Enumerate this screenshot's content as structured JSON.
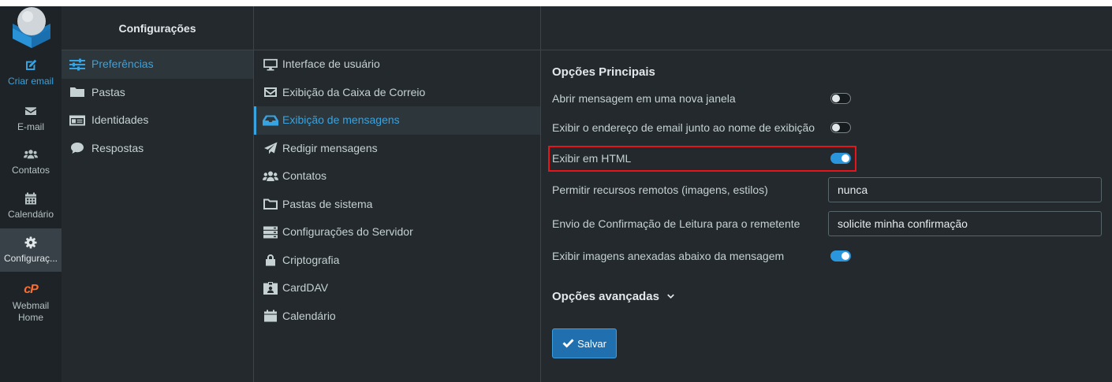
{
  "colors": {
    "background": "#23292d",
    "menu_background": "#1d2326",
    "accent": "#37a3e1",
    "toggle_on": "#2a97dc",
    "text": "#c5d1d3",
    "highlight_border": "#e8141c",
    "cpanel_orange": "#ff6c2c",
    "save_button": "#2070b0"
  },
  "menu": {
    "logo_icon": "roundcube-logo-icon",
    "items": [
      {
        "label": "Criar email",
        "icon": "compose-icon",
        "active": false
      },
      {
        "label": "E-mail",
        "icon": "envelope-icon",
        "active": false
      },
      {
        "label": "Contatos",
        "icon": "users-icon",
        "active": false
      },
      {
        "label": "Calendário",
        "icon": "calendar-icon",
        "active": false
      },
      {
        "label": "Configuraç...",
        "icon": "gear-icon",
        "active": true
      },
      {
        "label": "Webmail Home",
        "icon": "cpanel-icon",
        "logo_text": "cP",
        "active": false
      }
    ]
  },
  "sidebar": {
    "title": "Configurações",
    "items": [
      {
        "label": "Preferências",
        "icon": "sliders-icon",
        "selected": true
      },
      {
        "label": "Pastas",
        "icon": "folder-icon",
        "selected": false
      },
      {
        "label": "Identidades",
        "icon": "id-card-icon",
        "selected": false
      },
      {
        "label": "Respostas",
        "icon": "comment-icon",
        "selected": false
      }
    ]
  },
  "sections": {
    "items": [
      {
        "label": "Interface de usuário",
        "icon": "desktop-icon",
        "selected": false
      },
      {
        "label": "Exibição da Caixa de Correio",
        "icon": "envelope-outline-icon",
        "selected": false
      },
      {
        "label": "Exibição de mensagens",
        "icon": "inbox-icon",
        "selected": true
      },
      {
        "label": "Redigir mensagens",
        "icon": "paper-plane-icon",
        "selected": false
      },
      {
        "label": "Contatos",
        "icon": "users-icon",
        "selected": false
      },
      {
        "label": "Pastas de sistema",
        "icon": "folder-outline-icon",
        "selected": false
      },
      {
        "label": "Configurações do Servidor",
        "icon": "server-icon",
        "selected": false
      },
      {
        "label": "Criptografia",
        "icon": "lock-icon",
        "selected": false
      },
      {
        "label": "CardDAV",
        "icon": "id-badge-icon",
        "selected": false
      },
      {
        "label": "Calendário",
        "icon": "calendar-icon",
        "selected": false
      }
    ]
  },
  "content": {
    "heading": "Opções Principais",
    "rows": [
      {
        "label": "Abrir mensagem em uma nova janela",
        "control": "toggle",
        "checked": false
      },
      {
        "label": "Exibir o endereço de email junto ao nome de exibição",
        "control": "toggle",
        "checked": false
      },
      {
        "label": "Exibir em HTML",
        "control": "toggle",
        "checked": true,
        "highlighted": true
      },
      {
        "label": "Permitir recursos remotos (imagens, estilos)",
        "control": "select",
        "value": "nunca"
      },
      {
        "label": "Envio de Confirmação de Leitura para o remetente",
        "control": "select",
        "value": "solicite minha confirmação"
      },
      {
        "label": "Exibir imagens anexadas abaixo da mensagem",
        "control": "toggle",
        "checked": true
      }
    ],
    "advanced_label": "Opções avançadas",
    "save_label": "Salvar"
  }
}
